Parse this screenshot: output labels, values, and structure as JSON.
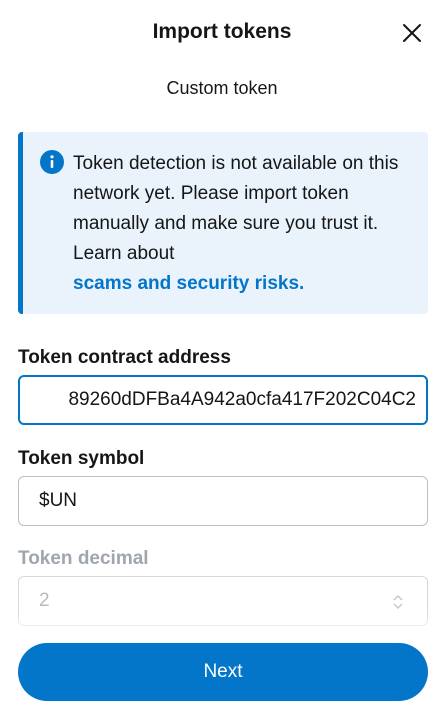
{
  "header": {
    "title": "Import tokens",
    "close_icon": "close-icon"
  },
  "tabs": [
    {
      "label": "Custom token",
      "selected": true
    }
  ],
  "banner": {
    "icon": "info-icon",
    "text": "Token detection is not available on this network yet. Please import token manually and make sure you trust it. Learn about",
    "link_text": "scams and security risks."
  },
  "form": {
    "contract_address": {
      "label": "Token contract address",
      "value": "89260dDFBa4A942a0cfa417F202C04C2"
    },
    "symbol": {
      "label": "Token symbol",
      "value": "$UN"
    },
    "decimal": {
      "label": "Token decimal",
      "value": "2",
      "disabled": true
    }
  },
  "footer": {
    "next_label": "Next"
  },
  "colors": {
    "accent": "#0376c9",
    "banner_bg": "#eaf2fb",
    "text": "#141618",
    "muted": "#9fa6ae"
  }
}
